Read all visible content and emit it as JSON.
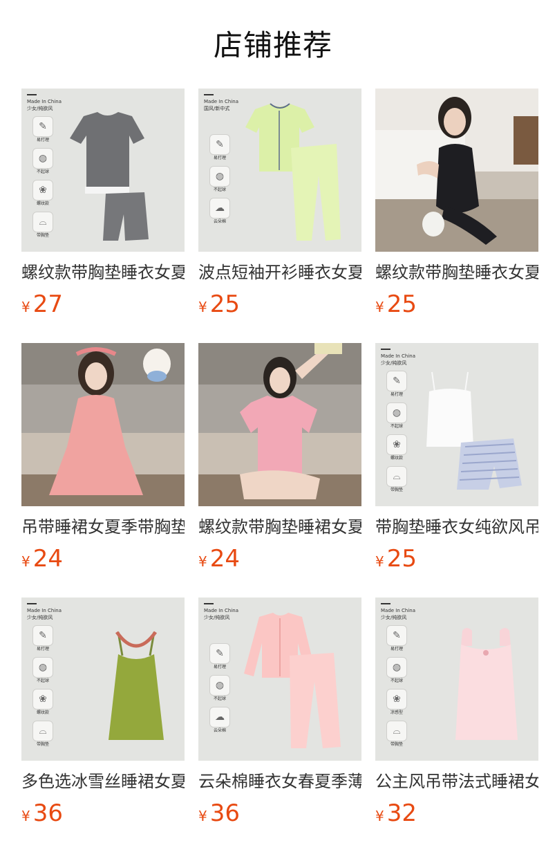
{
  "section_title": "店铺推荐",
  "products": [
    {
      "name": "螺纹款带胸垫睡衣女夏",
      "currency": "¥",
      "price": "27",
      "photo_type": "flatlay",
      "image_text": {
        "made_in": "Made In China",
        "style": "少女/纯欲风"
      },
      "features": [
        {
          "icon": "comb-icon",
          "label": "易打理"
        },
        {
          "icon": "pill-ball-icon",
          "label": "不起球"
        },
        {
          "icon": "fabric-icon",
          "label": "螺纹款"
        },
        {
          "icon": "bra-icon",
          "label": "带胸垫"
        }
      ]
    },
    {
      "name": "波点短袖开衫睡衣女夏",
      "currency": "¥",
      "price": "25",
      "photo_type": "flatlay",
      "image_text": {
        "made_in": "Made In China",
        "style": "国风/新中式"
      },
      "features": [
        {
          "icon": "comb-icon",
          "label": "易打理"
        },
        {
          "icon": "pill-ball-icon",
          "label": "不起球"
        },
        {
          "icon": "cloud-icon",
          "label": "云朵棉"
        }
      ]
    },
    {
      "name": "螺纹款带胸垫睡衣女夏",
      "currency": "¥",
      "price": "25",
      "photo_type": "model"
    },
    {
      "name": "吊带睡裙女夏季带胸垫",
      "currency": "¥",
      "price": "24",
      "photo_type": "model"
    },
    {
      "name": "螺纹款带胸垫睡裙女夏",
      "currency": "¥",
      "price": "24",
      "photo_type": "model"
    },
    {
      "name": "带胸垫睡衣女纯欲风吊",
      "currency": "¥",
      "price": "25",
      "photo_type": "flatlay",
      "image_text": {
        "made_in": "Made In China",
        "style": "少女/纯欲风"
      },
      "features": [
        {
          "icon": "comb-icon",
          "label": "易打理"
        },
        {
          "icon": "pill-ball-icon",
          "label": "不起球"
        },
        {
          "icon": "fabric-icon",
          "label": "螺纹款"
        },
        {
          "icon": "bra-icon",
          "label": "带胸垫"
        }
      ]
    },
    {
      "name": "多色选冰雪丝睡裙女夏",
      "currency": "¥",
      "price": "36",
      "photo_type": "flatlay",
      "image_text": {
        "made_in": "Made In China",
        "style": "少女/纯欲风"
      },
      "features": [
        {
          "icon": "comb-icon",
          "label": "易打理"
        },
        {
          "icon": "pill-ball-icon",
          "label": "不起球"
        },
        {
          "icon": "fabric-icon",
          "label": "螺纹款"
        },
        {
          "icon": "bra-icon",
          "label": "带胸垫"
        }
      ]
    },
    {
      "name": "云朵棉睡衣女春夏季薄",
      "currency": "¥",
      "price": "36",
      "photo_type": "flatlay",
      "image_text": {
        "made_in": "Made In China",
        "style": "少女/纯欲风"
      },
      "features": [
        {
          "icon": "comb-icon",
          "label": "易打理"
        },
        {
          "icon": "pill-ball-icon",
          "label": "不起球"
        },
        {
          "icon": "cloud-icon",
          "label": "云朵棉"
        }
      ]
    },
    {
      "name": "公主风吊带法式睡裙女",
      "currency": "¥",
      "price": "32",
      "photo_type": "flatlay",
      "image_text": {
        "made_in": "Made In China",
        "style": "少女/纯欲风"
      },
      "features": [
        {
          "icon": "comb-icon",
          "label": "易打理"
        },
        {
          "icon": "pill-ball-icon",
          "label": "不起球"
        },
        {
          "icon": "fabric-icon",
          "label": "凉感型"
        },
        {
          "icon": "bra-icon",
          "label": "带胸垫"
        }
      ]
    }
  ]
}
